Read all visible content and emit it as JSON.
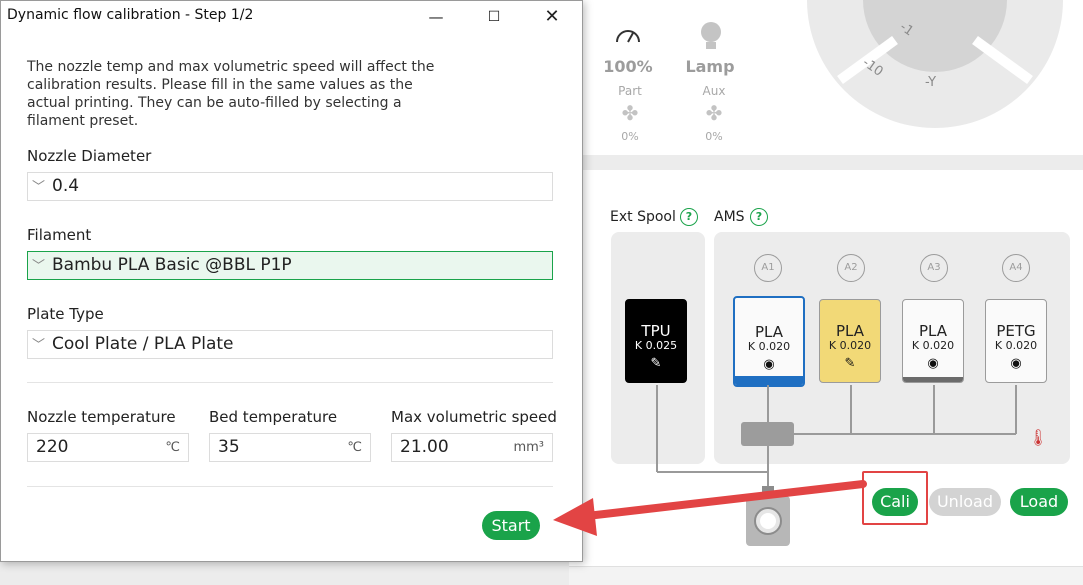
{
  "dialog": {
    "title": "Dynamic flow calibration - Step 1/2",
    "intro": "The nozzle temp and max volumetric speed will affect the calibration results. Please fill in the same values as the actual printing. They can be auto-filled by selecting a filament preset.",
    "nozzle_diameter_label": "Nozzle Diameter",
    "nozzle_diameter_value": "0.4",
    "filament_label": "Filament",
    "filament_value": "Bambu PLA Basic @BBL P1P",
    "plate_type_label": "Plate Type",
    "plate_type_value": "Cool Plate / PLA Plate",
    "nozzle_temp_label": "Nozzle temperature",
    "nozzle_temp_value": "220",
    "nozzle_temp_unit": "℃",
    "bed_temp_label": "Bed temperature",
    "bed_temp_value": "35",
    "bed_temp_unit": "℃",
    "max_speed_label": "Max volumetric speed",
    "max_speed_value": "21.00",
    "max_speed_unit": "mm³",
    "start_label": "Start"
  },
  "printer": {
    "jog_labels": [
      "-1",
      "-10",
      "-Y"
    ],
    "speed_value": "100%",
    "lamp_label": "Lamp",
    "part_label": "Part",
    "part_value": "0%",
    "aux_label": "Aux",
    "aux_value": "0%",
    "ext_spool_label": "Ext Spool",
    "ams_label": "AMS",
    "help_glyph": "?",
    "ext_slot": {
      "material": "TPU",
      "k": "K 0.025",
      "color": "#000000"
    },
    "ams_slots": [
      {
        "id": "A1",
        "material": "PLA",
        "k": "K 0.020",
        "color": "#ffffff",
        "bar": "#1f6fc2"
      },
      {
        "id": "A2",
        "material": "PLA",
        "k": "K 0.020",
        "color": "#f2d977",
        "bar": "#f2d977"
      },
      {
        "id": "A3",
        "material": "PLA",
        "k": "K 0.020",
        "color": "#ffffff",
        "bar": "#6b6b6b"
      },
      {
        "id": "A4",
        "material": "PETG",
        "k": "K 0.020",
        "color": "#ffffff",
        "bar": "#ffffff"
      }
    ],
    "cali_label": "Cali",
    "unload_label": "Unload",
    "load_label": "Load"
  },
  "colors": {
    "accent": "#1aa34a",
    "highlight": "#e24444"
  }
}
